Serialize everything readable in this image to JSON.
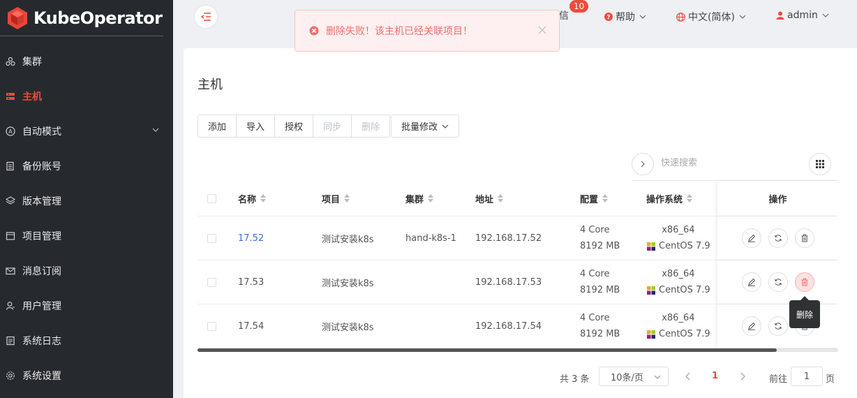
{
  "app": {
    "name": "KubeOperator",
    "brand_color": "#f04a3c"
  },
  "sidebar": {
    "items": [
      {
        "label": "集群",
        "icon": "cluster-icon"
      },
      {
        "label": "主机",
        "icon": "host-icon",
        "active": true
      },
      {
        "label": "自动模式",
        "icon": "auto-mode-icon",
        "has_children": true
      },
      {
        "label": "备份账号",
        "icon": "backup-icon"
      },
      {
        "label": "版本管理",
        "icon": "version-icon"
      },
      {
        "label": "项目管理",
        "icon": "project-icon"
      },
      {
        "label": "消息订阅",
        "icon": "mail-icon"
      },
      {
        "label": "用户管理",
        "icon": "user-icon"
      },
      {
        "label": "系统日志",
        "icon": "log-icon"
      },
      {
        "label": "系统设置",
        "icon": "settings-icon"
      }
    ]
  },
  "header": {
    "message_label": "信",
    "message_count": "10",
    "help_label": "帮助",
    "language_label": "中文(简体)",
    "user_label": "admin"
  },
  "alert": {
    "type": "error",
    "message": "删除失败！该主机已经关联项目！"
  },
  "page": {
    "title": "主机",
    "toolbar": {
      "add": "添加",
      "import": "导入",
      "authorize": "授权",
      "sync": "同步",
      "delete": "删除",
      "batch_edit": "批量修改"
    },
    "search_placeholder": "快速搜索"
  },
  "table": {
    "columns": {
      "name": "名称",
      "project": "项目",
      "cluster": "集群",
      "address": "地址",
      "config": "配置",
      "os": "操作系统",
      "actions": "操作"
    },
    "rows": [
      {
        "name": "17.52",
        "name_link": true,
        "project": "测试安装k8s",
        "cluster": "hand-k8s-1",
        "address": "192.168.17.52",
        "cpu": "4 Core",
        "memory": "8192 MB",
        "arch": "x86_64",
        "os": "CentOS 7.9"
      },
      {
        "name": "17.53",
        "name_link": false,
        "project": "测试安装k8s",
        "cluster": "",
        "address": "192.168.17.53",
        "cpu": "4 Core",
        "memory": "8192 MB",
        "arch": "x86_64",
        "os": "CentOS 7.9"
      },
      {
        "name": "17.54",
        "name_link": false,
        "project": "测试安装k8s",
        "cluster": "",
        "address": "192.168.17.54",
        "cpu": "4 Core",
        "memory": "8192 MB",
        "arch": "x86_64",
        "os": "CentOS 7.9"
      }
    ],
    "tooltip": "删除"
  },
  "pagination": {
    "total_label": "共 3 条",
    "page_size": "10条/页",
    "current_page": "1",
    "goto_label": "前往",
    "goto_value": "1",
    "page_suffix": "页"
  }
}
